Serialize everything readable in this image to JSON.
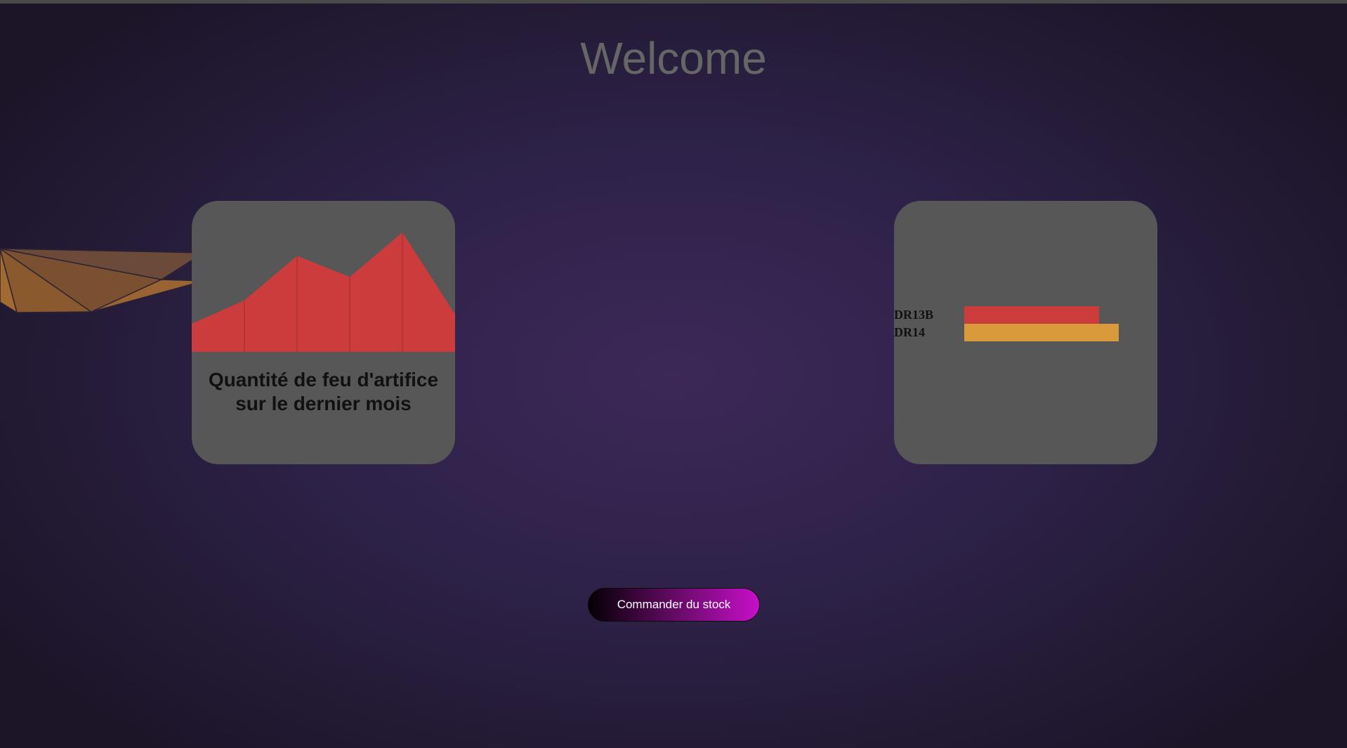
{
  "page": {
    "title": "Welcome"
  },
  "cards": {
    "left": {
      "caption_line1": "Quantité de feu d'artifice",
      "caption_line2": "sur le dernier mois"
    }
  },
  "actions": {
    "order_stock_label": "Commander du stock"
  },
  "colors": {
    "card_bg": "#575757",
    "series_red": "#cc3c3c",
    "series_orange": "#d99a3c",
    "title_text": "#666666",
    "button_gradient_end": "#c70fc9"
  },
  "chart_data": [
    {
      "type": "area",
      "title": "",
      "x": [
        0,
        1,
        2,
        3,
        4,
        5
      ],
      "values": [
        1.2,
        2.2,
        4.1,
        3.2,
        5.1,
        1.6
      ],
      "color": "#cc3c3c"
    },
    {
      "type": "bar",
      "orientation": "horizontal",
      "categories": [
        "DR13B",
        "DR14"
      ],
      "values": [
        192,
        220
      ],
      "colors": [
        "#cc3c3c",
        "#d99a3c"
      ]
    }
  ]
}
